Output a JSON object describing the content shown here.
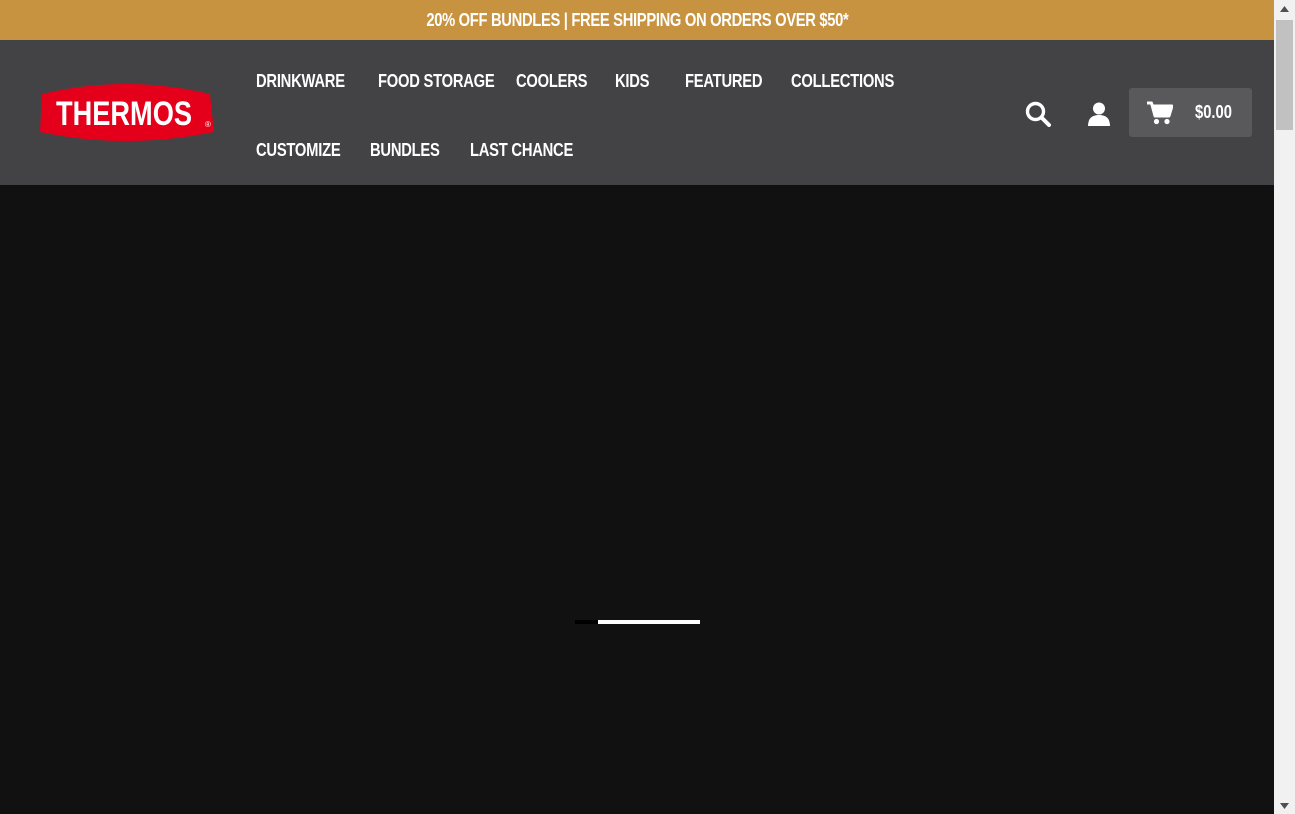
{
  "promo_banner": {
    "text": "20% OFF BUNDLES | FREE SHIPPING ON ORDERS OVER $50*",
    "background": "#c89340"
  },
  "header": {
    "background": "#434345",
    "logo": {
      "text": "THERMOS",
      "mark": "®",
      "color": "#e4001b"
    },
    "nav": [
      {
        "label": "DRINKWARE"
      },
      {
        "label": "FOOD STORAGE"
      },
      {
        "label": "COOLERS"
      },
      {
        "label": "KIDS"
      },
      {
        "label": "FEATURED"
      },
      {
        "label": "COLLECTIONS"
      },
      {
        "label": "CUSTOMIZE"
      },
      {
        "label": "BUNDLES"
      },
      {
        "label": "LAST CHANCE"
      }
    ],
    "icons": {
      "search": "search-icon",
      "account": "user-icon",
      "cart": "cart-icon"
    },
    "cart_total": "$0.00"
  },
  "hero": {
    "background": "#111111",
    "slider_progress": 0.82
  }
}
